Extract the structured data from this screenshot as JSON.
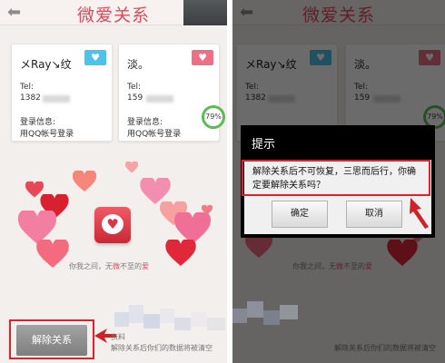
{
  "app": {
    "title": "微爱关系",
    "back_icon": "back-arrow-icon"
  },
  "cards": [
    {
      "name": "メRay↘纹",
      "tel_label": "Tel:",
      "tel_visible": "1382",
      "login_label": "登录信息:",
      "login_value": "用QQ帐号登录",
      "tag_color": "#4ec2ea",
      "tag_icon": "heart-icon"
    },
    {
      "name": "淡。",
      "tel_label": "Tel:",
      "tel_visible": "159",
      "login_label": "登录信息:",
      "login_value": "用QQ帐号登录",
      "tag_color": "#ef6f86",
      "tag_icon": "heart-icon"
    }
  ],
  "percent_badge": "79%",
  "slogan": {
    "prefix": "你我之间，无",
    "mid1": "微",
    "mid2": "不至的",
    "suffix": "爱"
  },
  "unbind_button": {
    "label": "解除关系"
  },
  "footer_note": {
    "line1": "解除关系后你们的数据将被清空",
    "partial": "资料"
  },
  "dialog": {
    "title": "提示",
    "message": "解除关系后不可恢复，三思而后行，你确定要解除关系吗？",
    "confirm_label": "确定",
    "cancel_label": "取消"
  },
  "colors": {
    "accent": "#e04a5c",
    "highlight_box": "#e0202a",
    "badge_green": "#5bbb55"
  }
}
